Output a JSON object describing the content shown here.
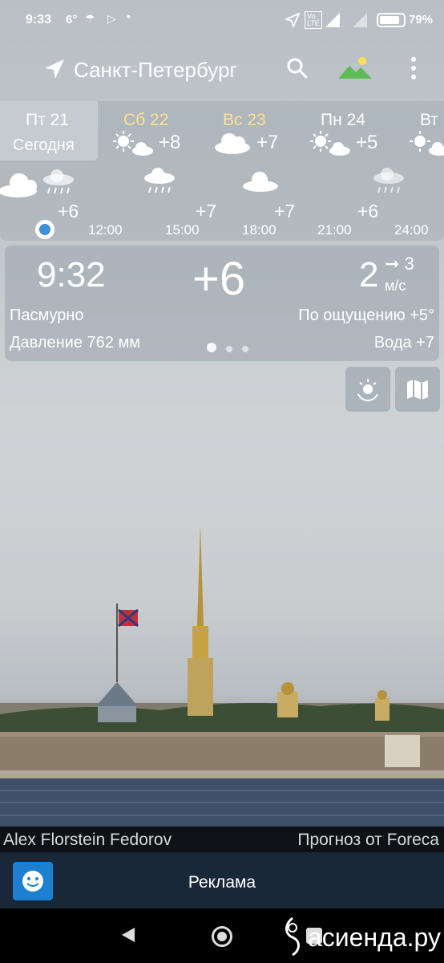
{
  "status": {
    "time": "9:33",
    "temp": "6°",
    "battery_percent": "79%",
    "icons": [
      "umbrella-icon",
      "play-icon",
      "dot-icon",
      "location-icon",
      "volte-icon",
      "signal-icon",
      "battery-icon"
    ]
  },
  "toolbar": {
    "city": "Санкт-Петербург",
    "icons": [
      "navigation-arrow-icon",
      "search-icon",
      "landscape-icon",
      "more-vert-icon"
    ]
  },
  "days": [
    {
      "name": "Пт 21",
      "sub": "Сегодня",
      "selected": true
    },
    {
      "name": "Сб 22",
      "temp": "+8",
      "weekend": true,
      "icon": "sun-cloud-icon"
    },
    {
      "name": "Вс 23",
      "temp": "+7",
      "weekend": true,
      "icon": "cloud-icon"
    },
    {
      "name": "Пн 24",
      "temp": "+5",
      "icon": "sun-cloud-icon"
    },
    {
      "name": "Вт",
      "icon": "sun-cloud-icon"
    }
  ],
  "hourly": {
    "temps": [
      "+6",
      "+7",
      "+7",
      "+6"
    ],
    "labels": [
      "12:00",
      "15:00",
      "18:00",
      "21:00",
      "24:00"
    ]
  },
  "current": {
    "time": "9:32",
    "temp": "+6",
    "wind_speed": "2",
    "wind_gust": "3",
    "wind_unit": "м/с",
    "condition": "Пасмурно",
    "feels_like": "По ощущению +5°",
    "pressure": "Давление 762 мм",
    "water": "Вода +7"
  },
  "photo": {
    "author": "Alex Florstein Fedorov",
    "source": "Прогноз от Foreca"
  },
  "ad": {
    "label": "Реклама"
  },
  "watermark": "асиенда.ру",
  "colors": {
    "weekend": "#ffe090",
    "now_dot": "#3f8fd9"
  }
}
